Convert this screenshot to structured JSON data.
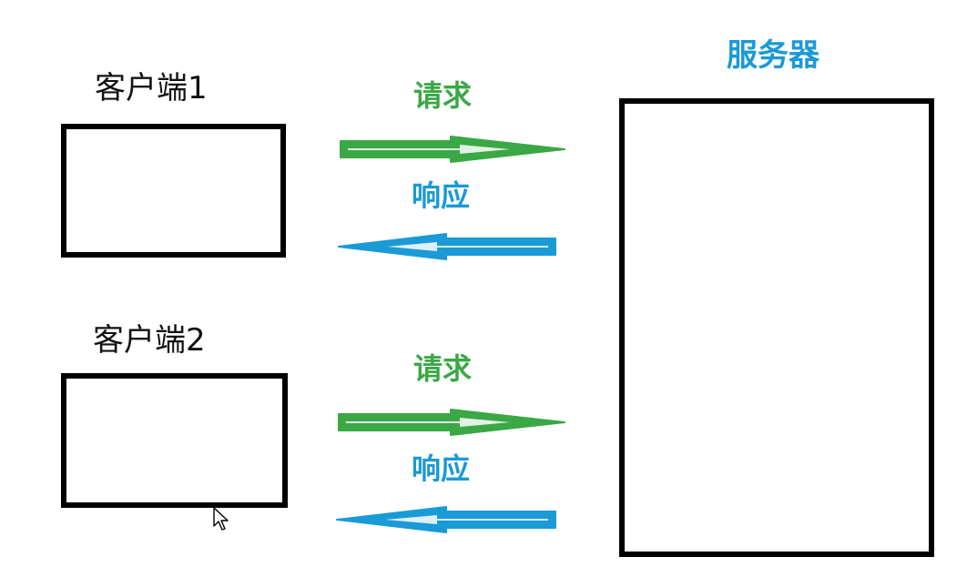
{
  "clients": [
    {
      "label": "客户端1"
    },
    {
      "label": "客户端2"
    }
  ],
  "server": {
    "label": "服务器"
  },
  "exchanges": [
    {
      "request_label": "请求",
      "response_label": "响应"
    },
    {
      "request_label": "请求",
      "response_label": "响应"
    }
  ],
  "colors": {
    "request": "#3aa845",
    "response": "#1a9ad6",
    "box_border": "#000000"
  }
}
